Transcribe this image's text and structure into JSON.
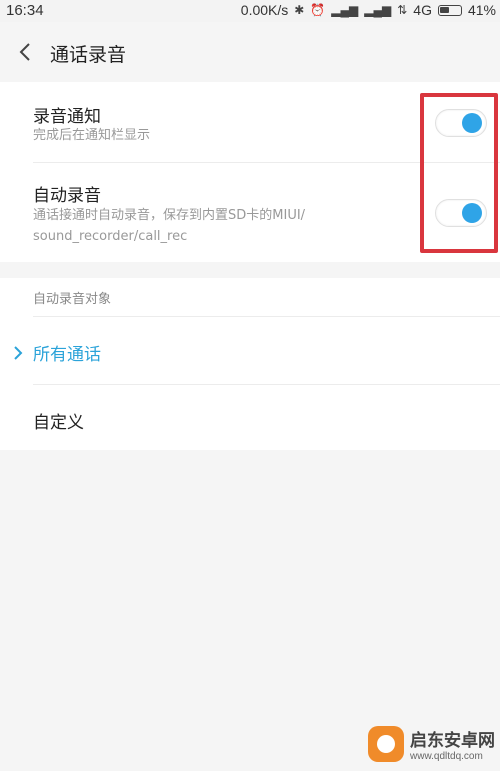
{
  "status_bar": {
    "time": "16:34",
    "speed": "0.00K/s",
    "network": "4G",
    "battery": "41%"
  },
  "header": {
    "title": "通话录音"
  },
  "settings": {
    "record_notify": {
      "title": "录音通知",
      "subtitle": "完成后在通知栏显示",
      "enabled": true
    },
    "auto_record": {
      "title": "自动录音",
      "subtitle_line1": "通话接通时自动录音，保存到内置SD卡的MIUI/",
      "subtitle_line2": "sound_recorder/call_rec",
      "enabled": true
    }
  },
  "targets": {
    "section_label": "自动录音对象",
    "options": [
      {
        "label": "所有通话",
        "selected": true
      },
      {
        "label": "自定义",
        "selected": false
      }
    ]
  },
  "watermark": {
    "name": "启东安卓网",
    "url": "www.qdltdq.com"
  },
  "colors": {
    "accent": "#2ba3d9",
    "toggle_on": "#2fa4e7",
    "highlight": "#d9363e"
  }
}
